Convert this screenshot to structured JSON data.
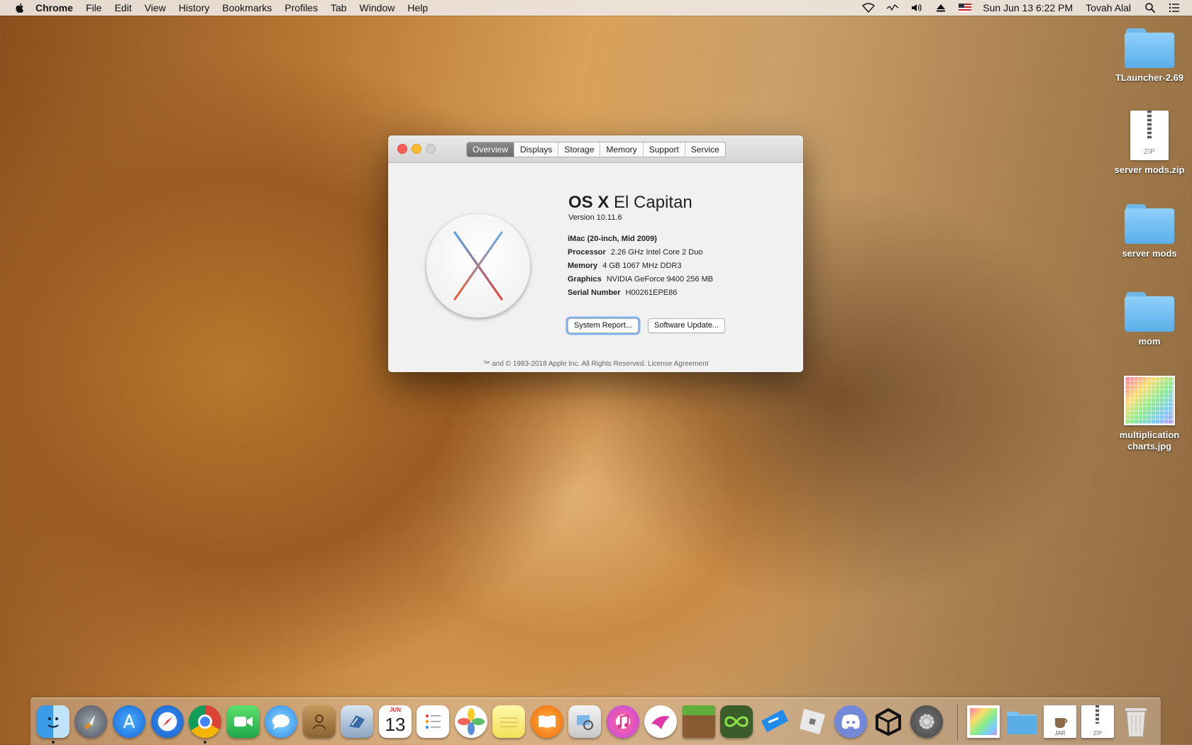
{
  "menubar": {
    "app": "Chrome",
    "items": [
      "File",
      "Edit",
      "View",
      "History",
      "Bookmarks",
      "Profiles",
      "Tab",
      "Window",
      "Help"
    ],
    "datetime": "Sun Jun 13  6:22 PM",
    "user": "Tovah Alal"
  },
  "desktop": {
    "icons": [
      {
        "label": "TLauncher-2.69",
        "kind": "folder"
      },
      {
        "label": "server mods.zip",
        "kind": "zip"
      },
      {
        "label": "server mods",
        "kind": "folder"
      },
      {
        "label": "mom",
        "kind": "folder"
      },
      {
        "label": "multiplication charts.jpg",
        "kind": "image"
      }
    ]
  },
  "window": {
    "tabs": [
      "Overview",
      "Displays",
      "Storage",
      "Memory",
      "Support",
      "Service"
    ],
    "active_tab": "Overview",
    "os_name_bold": "OS X",
    "os_name_rest": "El Capitan",
    "version": "Version 10.11.6",
    "model": "iMac (20-inch, Mid 2009)",
    "specs": [
      {
        "key": "Processor",
        "value": "2.26 GHz Intel Core 2 Duo"
      },
      {
        "key": "Memory",
        "value": "4 GB 1067 MHz DDR3"
      },
      {
        "key": "Graphics",
        "value": "NVIDIA GeForce 9400 256 MB"
      },
      {
        "key": "Serial Number",
        "value": "H00261EPE86"
      }
    ],
    "buttons": {
      "system_report": "System Report...",
      "software_update": "Software Update..."
    },
    "footer": "™ and © 1983-2018 Apple Inc. All Rights Reserved. License Agreement"
  },
  "dock": {
    "calendar_month": "JUN",
    "calendar_day": "13",
    "jar_label": "JAR",
    "zip_label": "ZIP"
  },
  "colors": {
    "close": "#fc5f57",
    "minimize": "#fdbc2e",
    "folder_blue": "#5aaee8",
    "focus_ring": "#5096f0"
  }
}
